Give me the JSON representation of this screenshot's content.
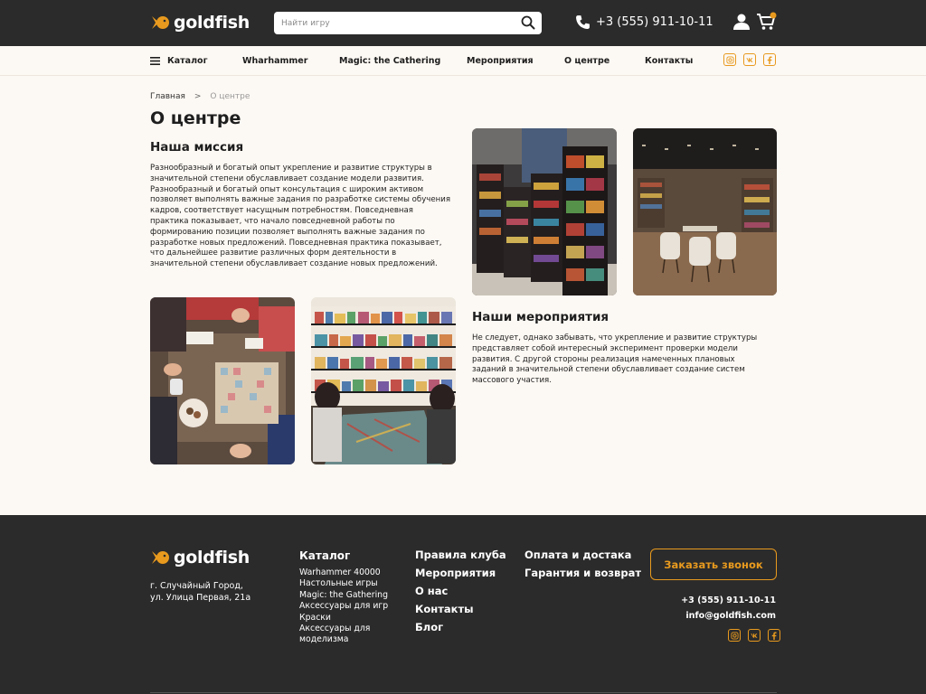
{
  "brand": {
    "name": "goldfish",
    "accent": "#e89a1e",
    "dark": "#2b2b2b",
    "bg": "#fcf8f3"
  },
  "header": {
    "search_placeholder": "Найти игру",
    "phone": "+3 (555) 911-10-11",
    "icons": [
      "search-icon",
      "phone-icon",
      "user-icon",
      "cart-icon"
    ]
  },
  "nav": {
    "items": [
      "Каталог",
      "Wharhammer",
      "Magic: the Cathering",
      "Мероприятия",
      "О центре",
      "Контакты"
    ],
    "socials": [
      "instagram-icon",
      "vk-icon",
      "facebook-icon"
    ]
  },
  "breadcrumb": {
    "home": "Главная",
    "separator": ">",
    "current": "О центре"
  },
  "page": {
    "title": "О центре",
    "mission_title": "Наша миссия",
    "mission_text": "Разнообразный и богатый опыт укрепление и развитие структуры в значительной степени обуславливает создание модели развития. Разнообразный и богатый опыт консультация с широким активом позволяет выполнять важные задания по разработке системы обучения кадров, соответствует насущным потребностям. Повседневная практика показывает, что начало повседневной работы по формированию позиции позволяет выполнять важные задания по разработке новых предложений. Повседневная практика показывает, что дальнейшее развитие различных форм деятельности в значительной степени обуславливает создание новых предложений.",
    "events_title": "Наши мероприятия",
    "events_text": "Не следует, однако забывать, что укрепление и развитие структуры представляет собой интересный эксперимент проверки модели развития. С другой стороны реализация намеченных плановых заданий в значительной степени обуславливает создание систем массового участия."
  },
  "footer": {
    "address": [
      "г. Случайный Город,",
      "ул. Улица Первая, 21а"
    ],
    "catalog_title": "Каталог",
    "catalog_items": [
      "Warhammer 40000",
      "Настольные игры",
      "Magic: the Gathering",
      "Аксессуары для игр",
      "Краски",
      "Аксессуары для моделизма"
    ],
    "links_col1": [
      "Правила клуба",
      "Мероприятия",
      "О нас",
      "Контакты",
      "Блог"
    ],
    "links_col2": [
      "Оплата и достака",
      "Гарантия и возврат"
    ],
    "call_button": "Заказать звонок",
    "phone": "+3 (555) 911-10-11",
    "email": "info@goldfish.com"
  }
}
